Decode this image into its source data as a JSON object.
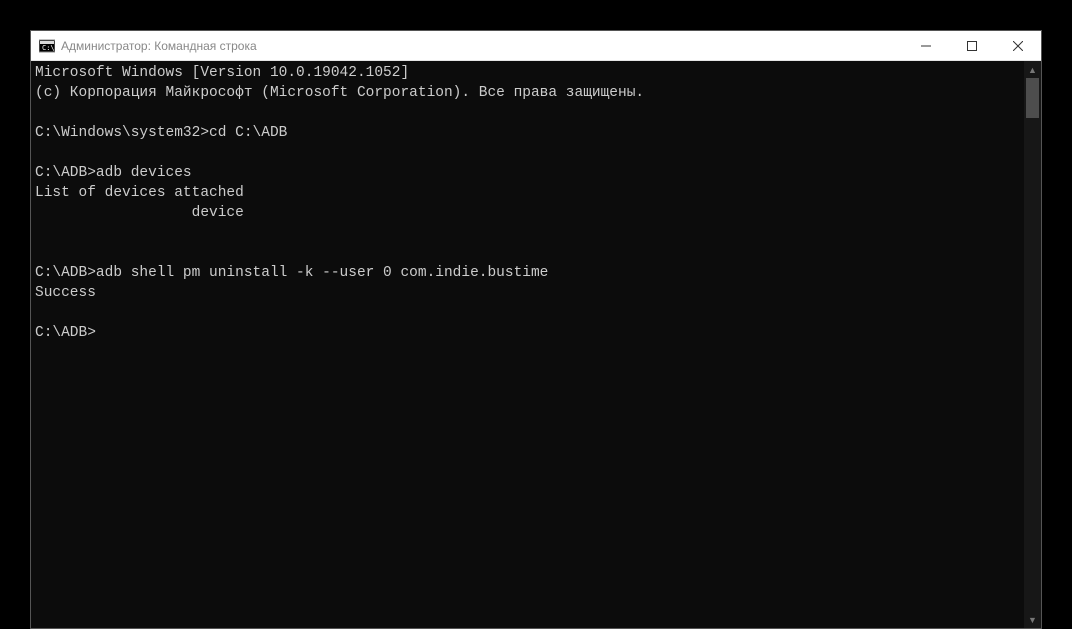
{
  "window": {
    "title": "Администратор: Командная строка"
  },
  "terminal": {
    "lines": [
      "Microsoft Windows [Version 10.0.19042.1052]",
      "(c) Корпорация Майкрософт (Microsoft Corporation). Все права защищены.",
      "",
      "C:\\Windows\\system32>cd C:\\ADB",
      "",
      "C:\\ADB>adb devices",
      "List of devices attached",
      "                  device",
      "",
      "",
      "C:\\ADB>adb shell pm uninstall -k --user 0 com.indie.bustime",
      "Success",
      "",
      "C:\\ADB>"
    ]
  }
}
